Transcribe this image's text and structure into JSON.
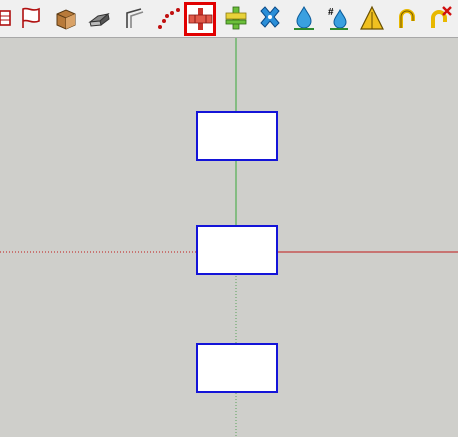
{
  "toolbar": {
    "tools": [
      {
        "icon": "section-plane-icon"
      },
      {
        "icon": "section-flag-icon"
      },
      {
        "icon": "box-3d-icon"
      },
      {
        "icon": "extrude-icon"
      },
      {
        "icon": "offset-icon"
      },
      {
        "icon": "dots-curve-icon"
      },
      {
        "icon": "red-cross-array-icon",
        "active": true
      },
      {
        "icon": "green-cross-icon"
      },
      {
        "icon": "blue-x-icon"
      },
      {
        "icon": "water-drop-icon"
      },
      {
        "icon": "numbered-drop-icon"
      },
      {
        "icon": "triangle-warning-icon"
      },
      {
        "icon": "rotate-arc-icon"
      },
      {
        "icon": "rotate-cancel-icon"
      }
    ]
  },
  "colors": {
    "background": "#cfcfcb",
    "green_axis": "#3aa83a",
    "red_axis": "#c01818",
    "box_border": "#1414d8",
    "active_tool_border": "#e10000"
  }
}
